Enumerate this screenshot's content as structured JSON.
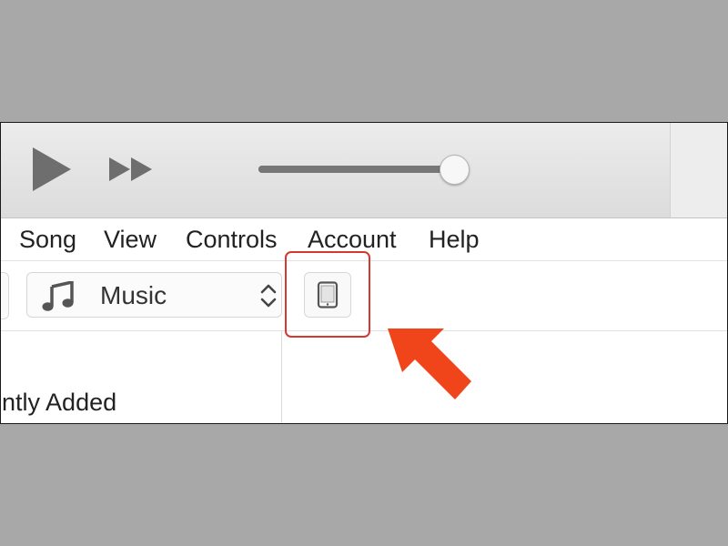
{
  "player": {
    "play_icon": "play-icon",
    "fast_forward_icon": "fast-forward-icon",
    "volume_level": 0.86
  },
  "menu": {
    "items": [
      "Song",
      "View",
      "Controls",
      "Account",
      "Help"
    ]
  },
  "toolbar": {
    "media_selector": {
      "icon": "music-note-icon",
      "label": "Music",
      "chevron_icon": "up-down-chevron-icon"
    },
    "device_button_icon": "device-icon"
  },
  "sidebar": {
    "items": [
      "ently Added"
    ]
  },
  "annotation": {
    "highlight_color": "#d5382e",
    "arrow_color": "#f0441b"
  }
}
